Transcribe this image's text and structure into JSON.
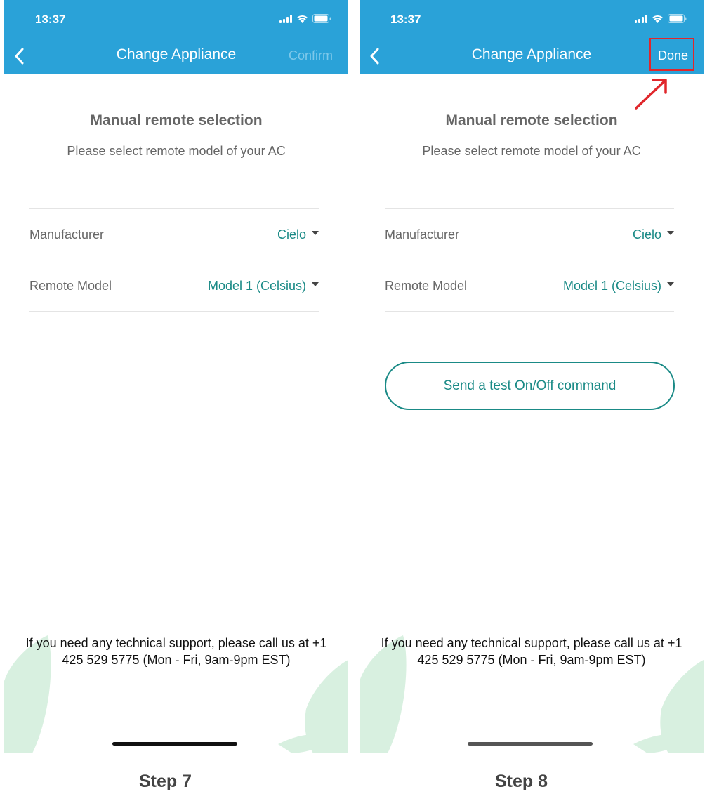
{
  "status_bar": {
    "time": "13:37"
  },
  "steps": [
    {
      "nav": {
        "title": "Change Appliance",
        "action": "Confirm"
      },
      "heading": "Manual remote selection",
      "subheading": "Please select remote model of your AC",
      "manufacturer": {
        "label": "Manufacturer",
        "value": "Cielo"
      },
      "remote_model": {
        "label": "Remote Model",
        "value": "Model 1 (Celsius)"
      },
      "support_text": "If you need any technical support, please call us at +1 425 529 5775 (Mon - Fri, 9am-9pm EST)",
      "caption": "Step 7"
    },
    {
      "nav": {
        "title": "Change Appliance",
        "action": "Done"
      },
      "heading": "Manual remote selection",
      "subheading": "Please select remote model of your AC",
      "manufacturer": {
        "label": "Manufacturer",
        "value": "Cielo"
      },
      "remote_model": {
        "label": "Remote Model",
        "value": "Model 1 (Celsius)"
      },
      "test_button": "Send a test On/Off command",
      "support_text": "If you need any technical support, please call us at +1 425 529 5775 (Mon - Fri, 9am-9pm EST)",
      "caption": "Step 8"
    }
  ],
  "colors": {
    "nav_bar": "#2aa2d8",
    "accent_teal": "#1a8a86",
    "disabled_action": "#7fc9ea",
    "highlight_red": "#e0262b",
    "leaf_green": "#d8f0e0"
  },
  "icons": [
    "back-chevron-icon",
    "signal-icon",
    "wifi-icon",
    "battery-icon",
    "dropdown-caret-icon",
    "leaf-decoration",
    "red-arrow-icon"
  ]
}
